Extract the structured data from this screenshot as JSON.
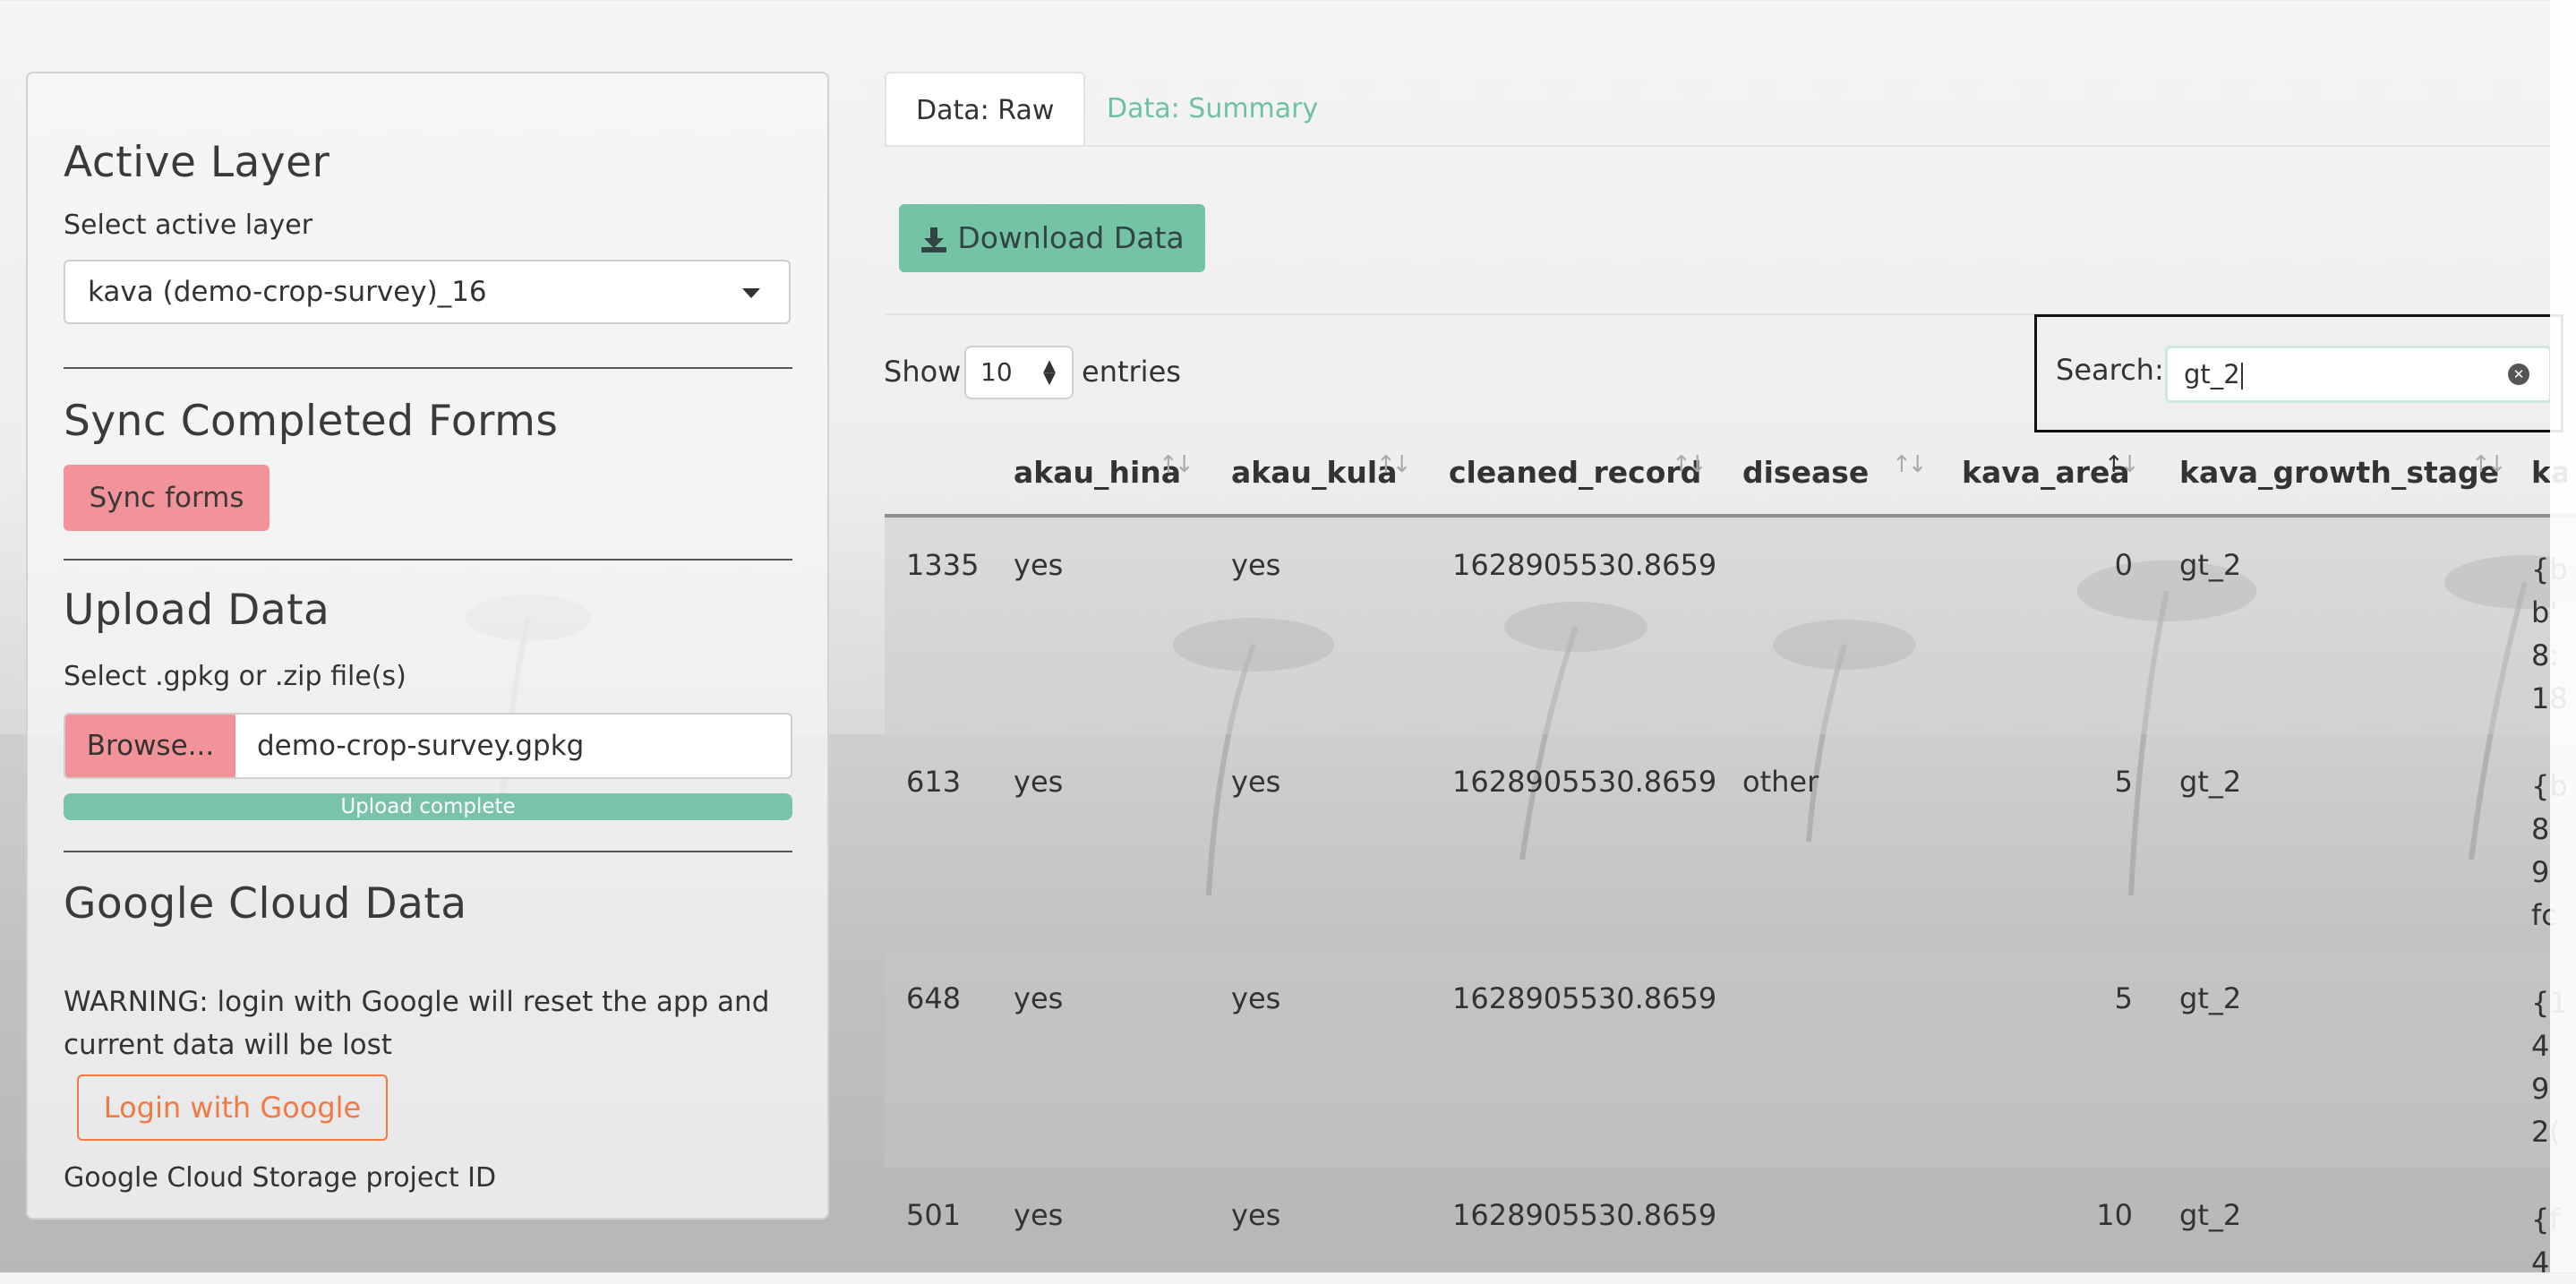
{
  "sidebar": {
    "active_layer": {
      "heading": "Active Layer",
      "label": "Select active layer",
      "selected": "kava (demo-crop-survey)_16"
    },
    "sync": {
      "heading": "Sync Completed Forms",
      "button": "Sync forms"
    },
    "upload": {
      "heading": "Upload Data",
      "label": "Select .gpkg or .zip file(s)",
      "browse": "Browse...",
      "filename": "demo-crop-survey.gpkg",
      "progress_label": "Upload complete",
      "progress": 1.0
    },
    "gcloud": {
      "heading": "Google Cloud Data",
      "warning": "WARNING: login with Google will reset the app and current data will be lost",
      "login_button": "Login with Google",
      "project_label": "Google Cloud Storage project ID"
    }
  },
  "tabs": [
    {
      "label": "Data: Raw",
      "active": true
    },
    {
      "label": "Data: Summary",
      "active": false
    }
  ],
  "toolbar": {
    "download_label": "Download Data"
  },
  "table_controls": {
    "show_label": "Show",
    "entries_value": "10",
    "entries_label": "entries",
    "search_label": "Search:",
    "search_value": "gt_2"
  },
  "table": {
    "columns": [
      "",
      "akau_hina",
      "akau_kula",
      "cleaned_record",
      "disease",
      "kava_area",
      "kava_growth_stage",
      "ka"
    ],
    "rows": [
      {
        "id": "1335",
        "akau_hina": "yes",
        "akau_kula": "yes",
        "cleaned_record": "1628905530.8659",
        "disease": "",
        "kava_area": "0",
        "kava_growth_stage": "gt_2",
        "cut": "{b\nb'\n8:\n18"
      },
      {
        "id": "613",
        "akau_hina": "yes",
        "akau_kula": "yes",
        "cleaned_record": "1628905530.8659",
        "disease": "other",
        "kava_area": "5",
        "kava_growth_stage": "gt_2",
        "cut": "{b\n8\n9\nfc"
      },
      {
        "id": "648",
        "akau_hina": "yes",
        "akau_kula": "yes",
        "cleaned_record": "1628905530.8659",
        "disease": "",
        "kava_area": "5",
        "kava_growth_stage": "gt_2",
        "cut": "{1\n4\n9\n2("
      },
      {
        "id": "501",
        "akau_hina": "yes",
        "akau_kula": "yes",
        "cleaned_record": "1628905530.8659",
        "disease": "",
        "kava_area": "10",
        "kava_growth_stage": "gt_2",
        "cut": "{f\n4"
      }
    ]
  },
  "colors": {
    "accent_green": "#74c3a5",
    "accent_red": "#f29399",
    "accent_orange": "#f07a45"
  },
  "icons": {
    "download": "download-icon",
    "dropdown": "caret-down-icon",
    "clear": "clear-search-icon",
    "sort": "sort-icon"
  }
}
